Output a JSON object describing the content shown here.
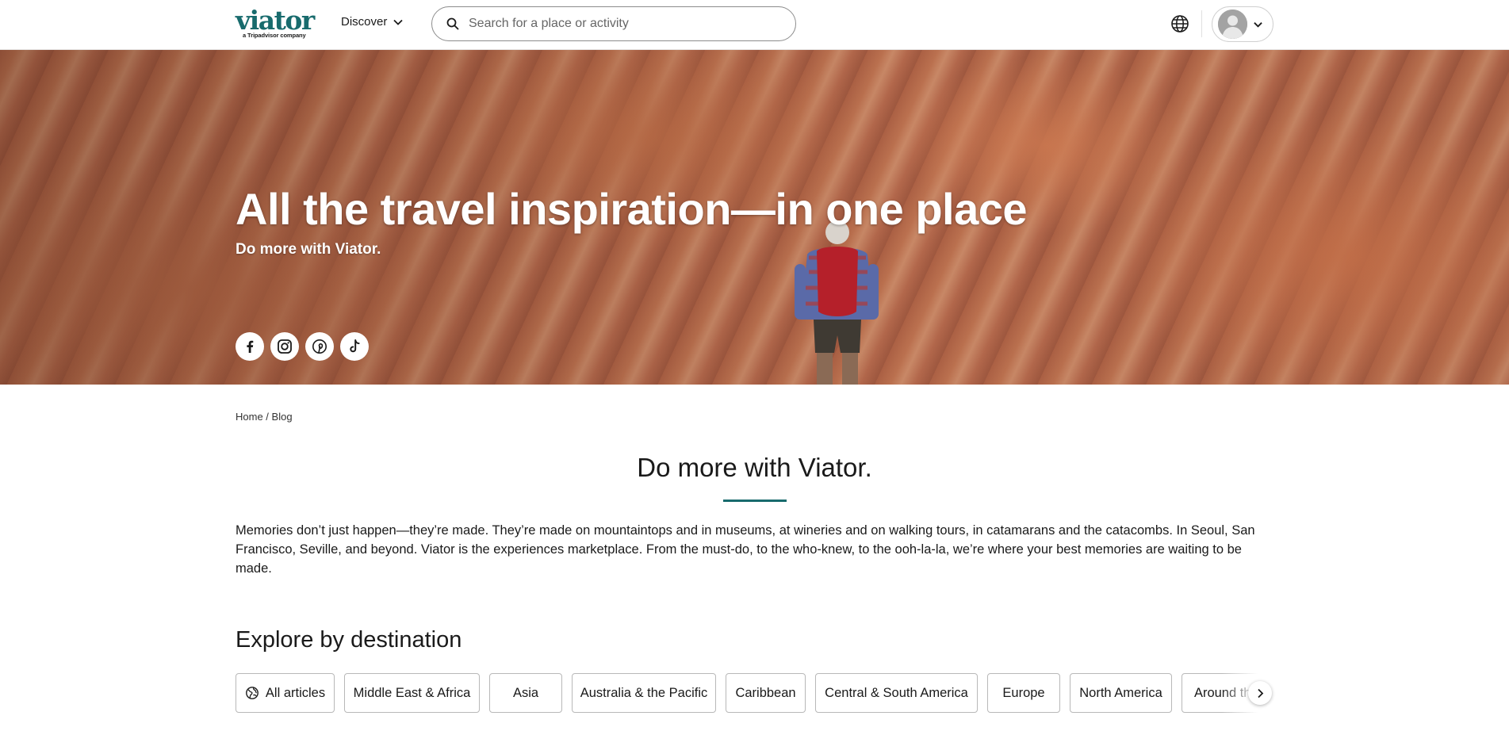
{
  "header": {
    "logo_text": "viator",
    "logo_sub": "a Tripadvisor company",
    "discover_label": "Discover",
    "search_placeholder": "Search for a place or activity",
    "icons": [
      "search-icon",
      "globe-icon",
      "avatar",
      "chevron-down-icon"
    ]
  },
  "hero": {
    "title": "All the travel inspiration—in one place",
    "subtitle": "Do more with Viator.",
    "socials": [
      "facebook-icon",
      "instagram-icon",
      "pinterest-icon",
      "tiktok-icon"
    ]
  },
  "breadcrumb": {
    "home": "Home",
    "separator": " / ",
    "current": "Blog"
  },
  "main": {
    "heading": "Do more with Viator.",
    "intro": "Memories don’t just happen—they’re made. They’re made on mountaintops and in museums, at wineries and on walking tours, in catamarans and the catacombs. In Seoul, San Francisco, Seville, and beyond. Viator is the experiences marketplace. From the must-do, to the who-knew, to the ooh-la-la, we’re where your best memories are waiting to be made."
  },
  "explore": {
    "title": "Explore by destination",
    "chips": [
      "All articles",
      "Middle East & Africa",
      "Asia",
      "Australia & the Pacific",
      "Caribbean",
      "Central & South America",
      "Europe",
      "North America",
      "Around the World"
    ]
  },
  "colors": {
    "brand": "#186b6d",
    "text": "#1a1a1a",
    "border": "#b8b8b8"
  }
}
